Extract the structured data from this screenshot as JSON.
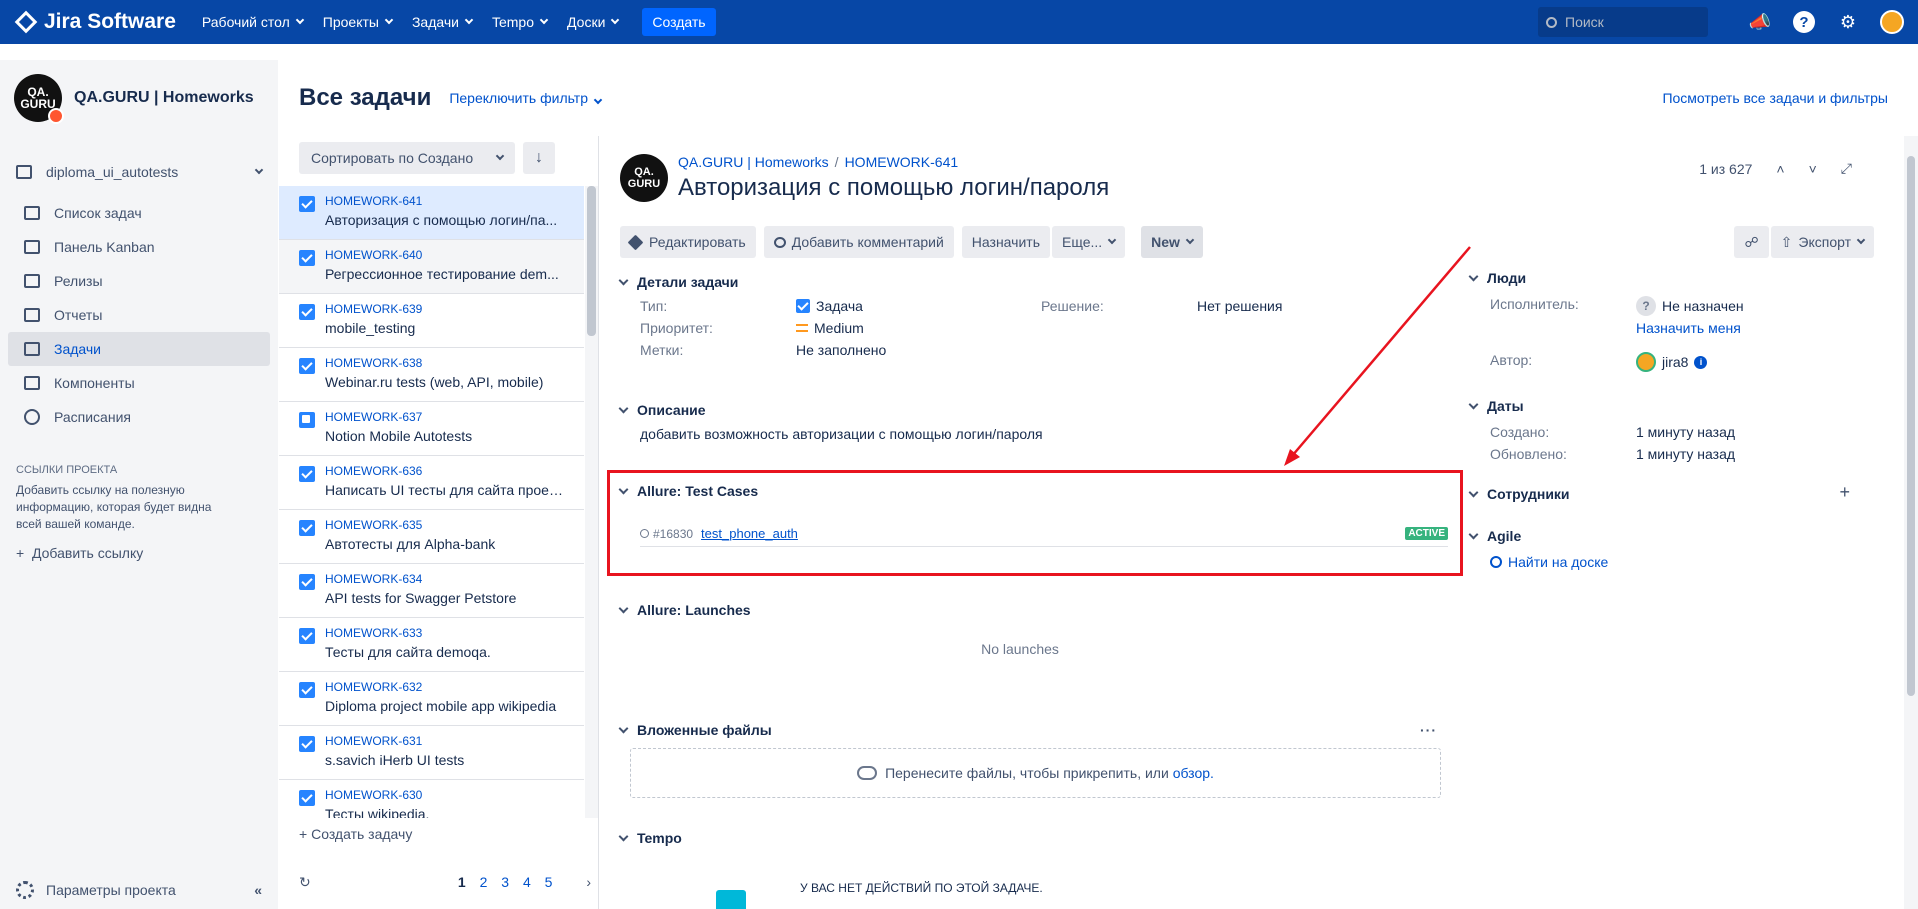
{
  "nav": {
    "brand": "Jira Software",
    "items": [
      "Рабочий стол",
      "Проекты",
      "Задачи",
      "Tempo",
      "Доски"
    ],
    "create": "Создать",
    "search_placeholder": "Поиск"
  },
  "sidebar": {
    "project_name": "QA.GURU | Homeworks",
    "avatar_text": "QA.\nGURU",
    "board": "diploma_ui_autotests",
    "items": [
      {
        "label": "Список задач",
        "icon": "backlog-icon"
      },
      {
        "label": "Панель Kanban",
        "icon": "board-icon"
      },
      {
        "label": "Релизы",
        "icon": "ship-icon"
      },
      {
        "label": "Отчеты",
        "icon": "chart-icon"
      },
      {
        "label": "Задачи",
        "icon": "issues-icon"
      },
      {
        "label": "Компоненты",
        "icon": "puzzle-icon"
      },
      {
        "label": "Расписания",
        "icon": "clock-icon"
      }
    ],
    "links_title": "ССЫЛКИ ПРОЕКТА",
    "links_desc": "Добавить ссылку на полезную информацию, которая будет видна всей вашей команде.",
    "add_link": "Добавить ссылку",
    "settings": "Параметры проекта"
  },
  "header": {
    "title": "Все задачи",
    "switch_filter": "Переключить фильтр",
    "view_all": "Посмотреть все задачи и фильтры"
  },
  "list": {
    "sort": "Сортировать по Создано",
    "issues": [
      {
        "key": "HOMEWORK-641",
        "summary": "Авторизация с помощью логин/па...",
        "type": "task"
      },
      {
        "key": "HOMEWORK-640",
        "summary": "Регрессионное тестирование dem...",
        "type": "task"
      },
      {
        "key": "HOMEWORK-639",
        "summary": "mobile_testing",
        "type": "task"
      },
      {
        "key": "HOMEWORK-638",
        "summary": "Webinar.ru tests (web, API, mobile)",
        "type": "task"
      },
      {
        "key": "HOMEWORK-637",
        "summary": "Notion Mobile Autotests",
        "type": "story"
      },
      {
        "key": "HOMEWORK-636",
        "summary": "Написать UI тесты для сайта проек...",
        "type": "task"
      },
      {
        "key": "HOMEWORK-635",
        "summary": "Автотесты для Alpha-bank",
        "type": "task"
      },
      {
        "key": "HOMEWORK-634",
        "summary": "API tests for Swagger Petstore",
        "type": "task"
      },
      {
        "key": "HOMEWORK-633",
        "summary": "Тесты для сайта demoqa.",
        "type": "task"
      },
      {
        "key": "HOMEWORK-632",
        "summary": "Diploma project mobile app wikipedia",
        "type": "task"
      },
      {
        "key": "HOMEWORK-631",
        "summary": "s.savich iHerb UI tests",
        "type": "task"
      },
      {
        "key": "HOMEWORK-630",
        "summary": "Тесты wikipedia.",
        "type": "task"
      }
    ],
    "create_task": "Создать задачу",
    "pages": [
      "1",
      "2",
      "3",
      "4",
      "5"
    ]
  },
  "issue": {
    "project": "QA.GURU | Homeworks",
    "key": "HOMEWORK-641",
    "title": "Авторизация с помощью логин/пароля",
    "position": "1 из 627",
    "actions": {
      "edit": "Редактировать",
      "comment": "Добавить комментарий",
      "assign": "Назначить",
      "more": "Еще...",
      "status": "New",
      "export": "Экспорт"
    },
    "details_title": "Детали задачи",
    "fields": {
      "type_label": "Тип:",
      "type_value": "Задача",
      "resolution_label": "Решение:",
      "resolution_value": "Нет решения",
      "priority_label": "Приоритет:",
      "priority_value": "Medium",
      "labels_label": "Метки:",
      "labels_value": "Не заполнено"
    },
    "description_title": "Описание",
    "description": "добавить возможность авторизации с помощью логин/пароля",
    "allure_tc_title": "Allure: Test Cases",
    "test_case": {
      "id": "#16830",
      "name": "test_phone_auth",
      "status": "ACTIVE"
    },
    "allure_launch_title": "Allure: Launches",
    "no_launches": "No launches",
    "files_title": "Вложенные файлы",
    "dropzone_text": "Перенесите файлы, чтобы прикрепить, или",
    "dropzone_link": "обзор.",
    "tempo_title": "Tempo",
    "tempo_msg": "У ВАС НЕТ ДЕЙСТВИЙ ПО ЭТОЙ ЗАДАЧЕ."
  },
  "right": {
    "people_title": "Люди",
    "assignee_label": "Исполнитель:",
    "assignee_value": "Не назначен",
    "assign_me": "Назначить меня",
    "author_label": "Автор:",
    "author_value": "jira8",
    "dates_title": "Даты",
    "created_label": "Создано:",
    "created_value": "1 минуту назад",
    "updated_label": "Обновлено:",
    "updated_value": "1 минуту назад",
    "collaborators_title": "Сотрудники",
    "agile_title": "Agile",
    "find_on_board": "Найти на доске"
  },
  "colors": {
    "nav_bg": "#0747a6",
    "accent": "#0052cc",
    "highlight_box": "#e8141f",
    "active_badge": "#36b37e"
  }
}
